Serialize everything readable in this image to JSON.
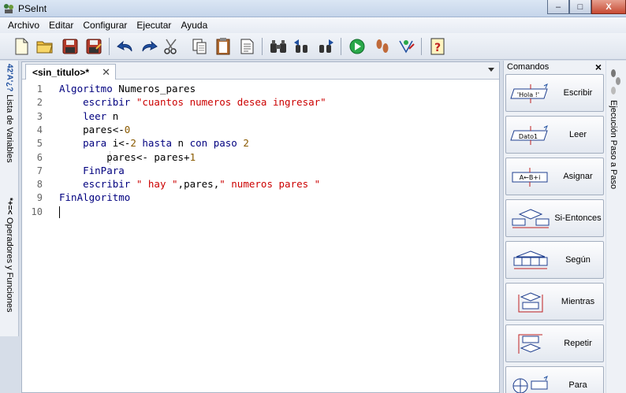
{
  "window": {
    "title": "PSeInt"
  },
  "menu": [
    "Archivo",
    "Editar",
    "Configurar",
    "Ejecutar",
    "Ayuda"
  ],
  "editor": {
    "tab_label": "<sin_titulo>*",
    "lines": [
      {
        "n": "1",
        "tokens": [
          {
            "t": "kw",
            "v": "Algoritmo"
          },
          {
            "t": "id",
            "v": " Numeros_pares"
          }
        ]
      },
      {
        "n": "2",
        "tokens": [
          {
            "t": "id",
            "v": "    "
          },
          {
            "t": "kw",
            "v": "escribir"
          },
          {
            "t": "id",
            "v": " "
          },
          {
            "t": "str",
            "v": "\"cuantos numeros desea ingresar\""
          }
        ]
      },
      {
        "n": "3",
        "tokens": [
          {
            "t": "id",
            "v": "    "
          },
          {
            "t": "kw",
            "v": "leer"
          },
          {
            "t": "id",
            "v": " n"
          }
        ]
      },
      {
        "n": "4",
        "tokens": [
          {
            "t": "id",
            "v": "    pares<-"
          },
          {
            "t": "num",
            "v": "0"
          }
        ]
      },
      {
        "n": "5",
        "tokens": [
          {
            "t": "id",
            "v": "    "
          },
          {
            "t": "kw",
            "v": "para"
          },
          {
            "t": "id",
            "v": " i<-"
          },
          {
            "t": "num",
            "v": "2"
          },
          {
            "t": "id",
            "v": " "
          },
          {
            "t": "kw",
            "v": "hasta"
          },
          {
            "t": "id",
            "v": " n "
          },
          {
            "t": "kw",
            "v": "con paso"
          },
          {
            "t": "id",
            "v": " "
          },
          {
            "t": "num",
            "v": "2"
          }
        ]
      },
      {
        "n": "6",
        "tokens": [
          {
            "t": "id",
            "v": "        pares<- pares+"
          },
          {
            "t": "num",
            "v": "1"
          }
        ]
      },
      {
        "n": "7",
        "tokens": [
          {
            "t": "id",
            "v": "    "
          },
          {
            "t": "kw",
            "v": "FinPara"
          }
        ]
      },
      {
        "n": "8",
        "tokens": [
          {
            "t": "id",
            "v": "    "
          },
          {
            "t": "kw",
            "v": "escribir"
          },
          {
            "t": "id",
            "v": " "
          },
          {
            "t": "str",
            "v": "\" hay \""
          },
          {
            "t": "id",
            "v": ",pares,"
          },
          {
            "t": "str",
            "v": "\" numeros pares \""
          }
        ]
      },
      {
        "n": "9",
        "tokens": [
          {
            "t": "kw",
            "v": "FinAlgoritmo"
          }
        ]
      },
      {
        "n": "10",
        "tokens": []
      }
    ]
  },
  "left_panel": {
    "variables_label": "Lista de Variables",
    "variables_icon": "*+=<",
    "operators_label": "Operadores y Funciones",
    "operators_icon": "42'A'¿?"
  },
  "commands": {
    "title": "Comandos",
    "close": "×",
    "buttons": [
      {
        "label": "Escribir",
        "icon_text": "'Hola !'"
      },
      {
        "label": "Leer",
        "icon_text": "Dato1"
      },
      {
        "label": "Asignar",
        "icon_text": "A←B+i"
      },
      {
        "label": "Si-Entonces",
        "icon_text": ""
      },
      {
        "label": "Según",
        "icon_text": ""
      },
      {
        "label": "Mientras",
        "icon_text": ""
      },
      {
        "label": "Repetir",
        "icon_text": ""
      },
      {
        "label": "Para",
        "icon_text": ""
      }
    ]
  },
  "right_panel": {
    "label": "Ejecución Paso a Paso"
  },
  "window_buttons": {
    "minimize": "–",
    "maximize": "□",
    "close": "X"
  }
}
